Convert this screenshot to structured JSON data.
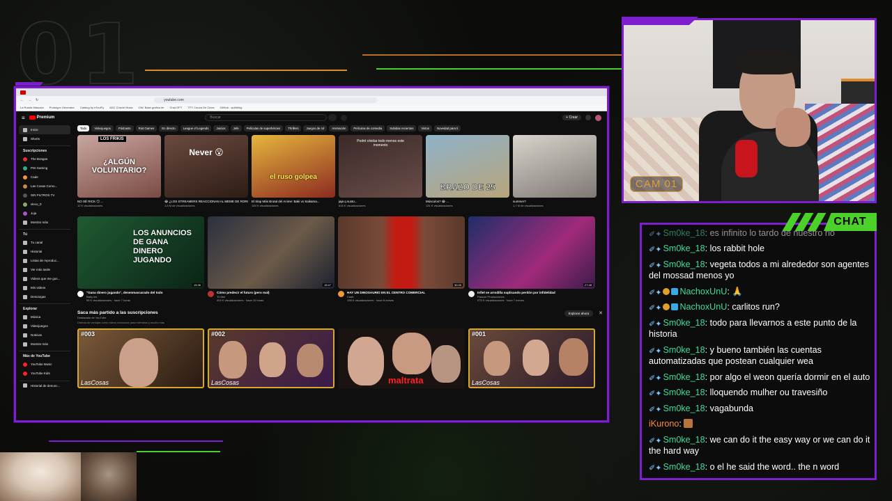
{
  "overlay": {
    "cam_label": "CAM 01",
    "chat_label": "CHAT",
    "accent": "#7d1fcf",
    "green": "#4cd12a"
  },
  "browser": {
    "url": "youtube.com",
    "bookmarks": [
      "La Rueda Mascota",
      "Prototype Generator",
      "Catalog by eToolFy",
      "ADC Chiché Music",
      "OW: Base gráfica de",
      "Chat GPT",
      "TFT: Cauca De Cinos",
      "GitHub - spit/bling"
    ]
  },
  "youtube": {
    "logo": "Premium",
    "search_placeholder": "Buscar",
    "create_label": "Crear",
    "sidebar": {
      "main": [
        {
          "label": "Inicio",
          "icon": "home-icon",
          "active": true
        },
        {
          "label": "Shorts",
          "icon": "shorts-icon"
        }
      ],
      "subs_head": "Suscripciones",
      "subs": [
        "The Bongos",
        "PSI Gaming",
        "Cade",
        "Las Cosas Como...",
        "SIN FILTROS TV",
        "vleco_0",
        "Juja",
        "Mostrar más"
      ],
      "you_head": "Tú",
      "you": [
        "Tu canal",
        "Historial",
        "Listas de reproduc...",
        "Ver más tarde",
        "Videos que me gus...",
        "Mis videos",
        "Descargas"
      ],
      "explore_head": "Explorar",
      "explore": [
        "Música",
        "Videojuegos",
        "Noticias",
        "Mostrar más"
      ],
      "more_head": "Más de YouTube",
      "more": [
        "YouTube Music",
        "YouTube Kids"
      ],
      "footer": "Historial de denunc..."
    },
    "chips": [
      "Todo",
      "Videojuegos",
      "Pódcasts",
      "Riot Games",
      "En directo",
      "League of Legends",
      "Juicios",
      "Jefe",
      "Películas de superhéroes",
      "Thrillers",
      "Juegos de rol",
      "Animación",
      "Películas de comedia",
      "Subidas recientes",
      "Vistos",
      "Novedad para ti"
    ],
    "shorts": [
      {
        "overlay": "¿ALGÚN VOLUNTARIO?",
        "tag": "LOS FRIKIS",
        "title": "NO SÉ RICK 😏 ...",
        "views": "12 K visualizaciones"
      },
      {
        "overlay": "Never 😮",
        "title": "😂 ¿LOS STREAMERS REACCIONAN AL MEME DE RORO Y PERSI",
        "views": "1,8 M de visualizaciones"
      },
      {
        "overlay": "el ruso golpea",
        "title": "El Slap Más Brutal del Anime: Baki vs Saikama...",
        "views": "145 K visualizaciones"
      },
      {
        "overlay": "Podré olvidar todo menos este momento",
        "title": "jaja q susto...",
        "views": "616 K visualizaciones"
      },
      {
        "overlay": "BRAZO DE 25",
        "title": "Músculos? 😂 ...",
        "views": "131 K visualizaciones"
      },
      {
        "overlay": "",
        "title": "summer?",
        "views": "1,7 M de visualizaciones"
      }
    ],
    "videos": [
      {
        "title": "\"Gana dinero jugando\", desenmascarado del todo",
        "channel": "Baby les",
        "meta": "55 K visualizaciones · hace 7 horas",
        "duration": "15:36",
        "thumb_text": "LOS ANUNCIOS DE GANA DINERO JUGANDO"
      },
      {
        "title": "Cómo predecir el futuro (pero mal)",
        "channel": "Tri bbe",
        "meta": "404 K visualizaciones · hace 15 horas",
        "duration": "15:47"
      },
      {
        "title": "HAY UN DINOSAURIO EN EL CENTRO COMERCIAL",
        "channel": "Cade",
        "meta": "198 K visualizaciones · hace 8 meses",
        "duration": "30:45"
      },
      {
        "title": "Infiel se arrodilla suplicando perdón por infidelidad",
        "channel": "Pascoe Producciones",
        "meta": "975 K visualizaciones · hace 7 meses",
        "duration": "27:48"
      }
    ],
    "section": {
      "title": "Saca más partido a las suscripciones",
      "subtitle": "Destacado de YouTube",
      "desc": "Disfruta de ventajas como vídeos exclusivos para miembros y mucho más",
      "explore_label": "Explorar ahora"
    },
    "members": [
      {
        "num": "#003",
        "brand": "LasCosas"
      },
      {
        "num": "#002",
        "brand": "LasCosas"
      },
      {
        "num": "",
        "brand": "maltrata"
      },
      {
        "num": "#001",
        "brand": "LasCosas"
      }
    ]
  },
  "chat": {
    "messages": [
      {
        "user": "Sm0ke_18",
        "text": "es infinito lo tardo de nuestro rio",
        "badges": [
          "tools"
        ]
      },
      {
        "user": "Sm0ke_18",
        "text": "los rabbit hole",
        "badges": [
          "tools"
        ]
      },
      {
        "user": "Sm0ke_18",
        "text": "vegeta todos a mi alrededor son agentes del mossad menos yo",
        "badges": [
          "tools"
        ]
      },
      {
        "user": "NachoxUnU",
        "text": "🙏",
        "badges": [
          "tools",
          "gold",
          "cube"
        ]
      },
      {
        "user": "NachoxUnU",
        "text": "carlitos run?",
        "badges": [
          "tools",
          "gold",
          "cube"
        ]
      },
      {
        "user": "Sm0ke_18",
        "text": "todo para llevarnos a este punto de la historia",
        "badges": [
          "tools"
        ]
      },
      {
        "user": "Sm0ke_18",
        "text": "y bueno también las cuentas automatizadas que postean cualquier wea",
        "badges": [
          "tools"
        ]
      },
      {
        "user": "Sm0ke_18",
        "text": "por algo el weon quería dormir en el auto",
        "badges": [
          "tools"
        ]
      },
      {
        "user": "Sm0ke_18",
        "text": "lloquendo mulher ou travesiño",
        "badges": [
          "tools"
        ]
      },
      {
        "user": "Sm0ke_18",
        "text": "vagabunda",
        "badges": [
          "tools"
        ]
      },
      {
        "user": "iKurono",
        "text": "",
        "badges": [],
        "emote": true,
        "orange": true
      },
      {
        "user": "Sm0ke_18",
        "text": "we can do it the easy way or we can do it the hard way",
        "badges": [
          "tools"
        ]
      },
      {
        "user": "Sm0ke_18",
        "text": "o el he said the word.. the n word",
        "badges": [
          "tools"
        ]
      }
    ]
  }
}
